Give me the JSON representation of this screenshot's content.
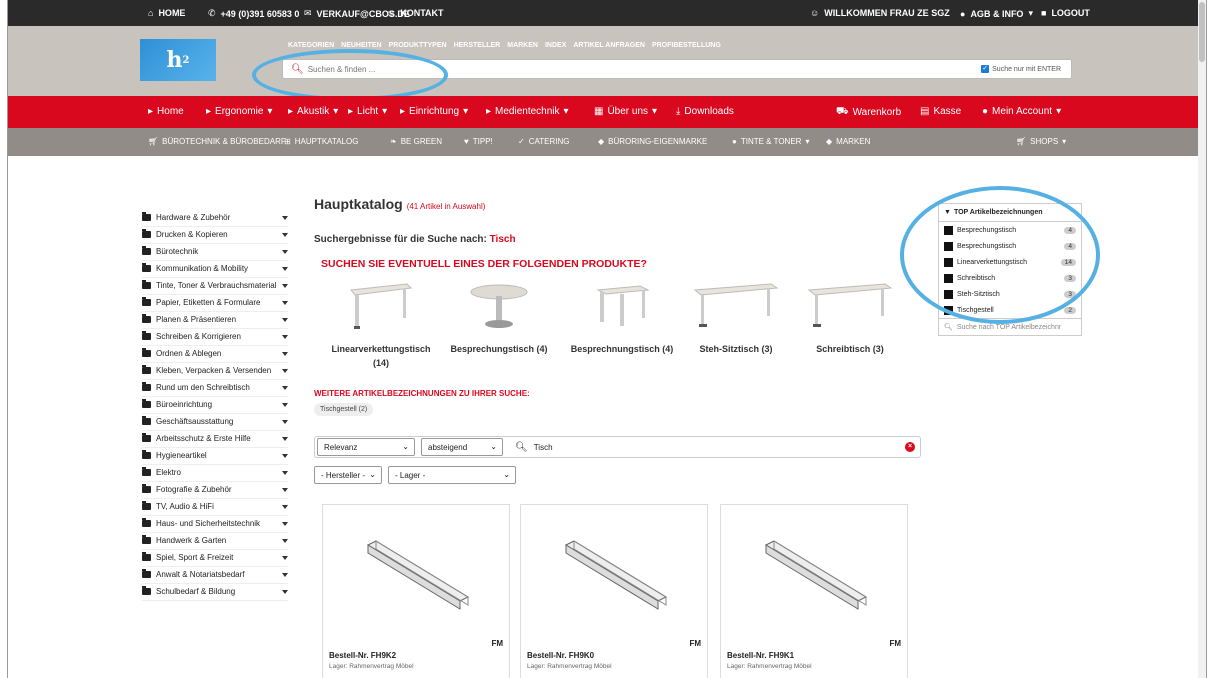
{
  "topbar": {
    "home": "HOME",
    "phone": "+49 (0)391 60583 0",
    "email": "VERKAUF@CBOS.DE",
    "contact": "KONTAKT",
    "welcome": "WILLKOMMEN FRAU ZE SGZ",
    "agb": "AGB & INFO",
    "logout": "LOGOUT"
  },
  "header": {
    "logo_text": "h",
    "logo_sup": "2",
    "nav": [
      "KATEGORIEN",
      "NEUHEITEN",
      "PRODUKTTYPEN",
      "HERSTELLER",
      "MARKEN",
      "INDEX",
      "ARTIKEL ANFRAGEN",
      "PROFIBESTELLUNG"
    ],
    "search_placeholder": "Suchen & finden ...",
    "enter_label": "Suche nur mit ENTER"
  },
  "rednav": {
    "home": "Home",
    "ergonomie": "Ergonomie",
    "akustik": "Akustik",
    "licht": "Licht",
    "einrichtung": "Einrichtung",
    "medientechnik": "Medientechnik",
    "ueber_uns": "Über uns",
    "downloads": "Downloads",
    "warenkorb": "Warenkorb",
    "kasse": "Kasse",
    "account": "Mein Account"
  },
  "greynav": {
    "buerotechnik": "BÜROTECHNIK & BÜROBEDARF",
    "hauptkatalog": "HAUPTKATALOG",
    "begreen": "BE GREEN",
    "tipp": "TIPP!",
    "catering": "CATERING",
    "eigenmarke": "BÜRORING-EIGENMARKE",
    "tinte": "TINTE & TONER",
    "marken": "MARKEN",
    "shops": "SHOPS"
  },
  "sidebar": {
    "items": [
      "Hardware & Zubehör",
      "Drucken & Kopieren",
      "Bürotechnik",
      "Kommunikation & Mobility",
      "Tinte, Toner & Verbrauchsmaterial",
      "Papier, Etiketten & Formulare",
      "Planen & Präsentieren",
      "Schreiben & Korrigieren",
      "Ordnen & Ablegen",
      "Kleben, Verpacken & Versenden",
      "Rund um den Schreibtisch",
      "Büroeinrichtung",
      "Geschäftsausstattung",
      "Arbeitsschutz & Erste Hilfe",
      "Hygieneartikel",
      "Elektro",
      "Fotografie & Zubehör",
      "TV, Audio & HiFi",
      "Haus- und Sicherheitstechnik",
      "Handwerk & Garten",
      "Spiel, Sport & Freizeit",
      "Anwalt & Notariatsbedarf",
      "Schulbedarf & Bildung"
    ]
  },
  "main": {
    "title": "Hauptkatalog",
    "count": "(41 Artikel in Auswahl)",
    "search_prefix": "Suchergebnisse für die Suche nach:",
    "search_term": "Tisch",
    "suggest_heading": "SUCHEN SIE EVENTUELL EINES DER FOLGENDEN PRODUKTE?",
    "products": [
      {
        "line1": "Linearverkettungstisch",
        "line2": "(14)"
      },
      {
        "line1": "Besprechungstisch (4)",
        "line2": ""
      },
      {
        "line1": "Besprechnungstisch (4)",
        "line2": ""
      },
      {
        "line1": "Steh-Sitztisch (3)",
        "line2": ""
      },
      {
        "line1": "Schreibtisch (3)",
        "line2": ""
      }
    ],
    "more_heading": "WEITERE ARTIKELBEZEICHNUNGEN ZU IHRER SUCHE:",
    "tag": "Tischgestell (2)",
    "sort": "Relevanz",
    "order": "absteigend",
    "filter_search": "Tisch",
    "hersteller": "- Hersteller -",
    "lager": "- Lager -",
    "cards": [
      {
        "brand": "FM",
        "nr": "Bestell-Nr. FH9K2",
        "lager": "Lager: Rahmenvertrag Möbel"
      },
      {
        "brand": "FM",
        "nr": "Bestell-Nr. FH9K0",
        "lager": "Lager: Rahmenvertrag Möbel"
      },
      {
        "brand": "FM",
        "nr": "Bestell-Nr. FH9K1",
        "lager": "Lager: Rahmenvertrag Möbel"
      }
    ]
  },
  "toppanel": {
    "title": "TOP Artikelbezeichnungen",
    "items": [
      {
        "label": "Besprechungstisch",
        "count": "4"
      },
      {
        "label": "Besprechungstisch",
        "count": "4"
      },
      {
        "label": "Linearverkettungstisch",
        "count": "14"
      },
      {
        "label": "Schreibtisch",
        "count": "3"
      },
      {
        "label": "Steh-Sitztisch",
        "count": "3"
      },
      {
        "label": "Tischgestell",
        "count": "2"
      }
    ],
    "search_placeholder": "Suche nach TOP Artikelbezeichnr"
  },
  "colors": {
    "red": "#d9081f",
    "dark": "#2a2a2a",
    "grey": "#918c88",
    "header": "#c9c3be",
    "highlight": "#55b0e4"
  }
}
